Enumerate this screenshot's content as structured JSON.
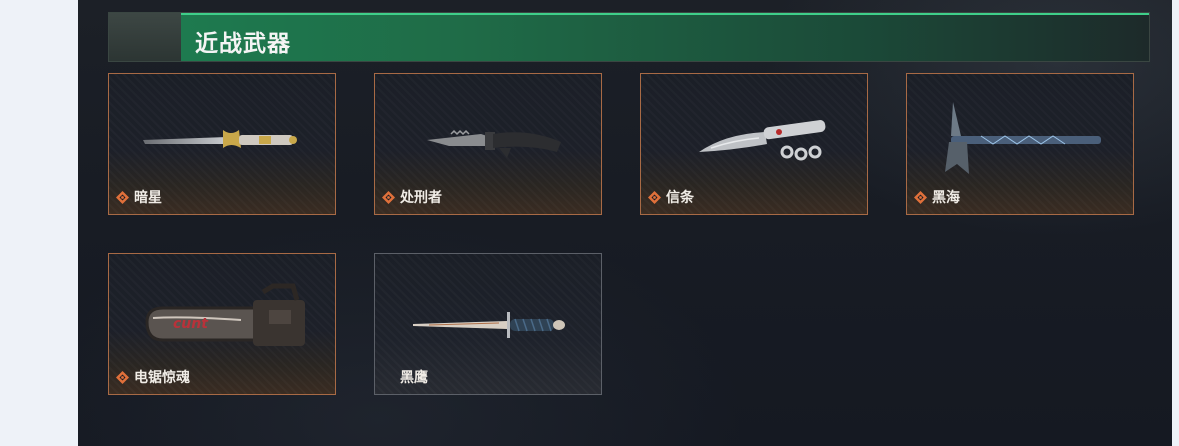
{
  "section": {
    "title": "近战武器"
  },
  "weapons": [
    {
      "name": "暗星",
      "rarity_icon": "orange-diamond-icon"
    },
    {
      "name": "处刑者",
      "rarity_icon": "orange-diamond-icon"
    },
    {
      "name": "信条",
      "rarity_icon": "orange-diamond-icon"
    },
    {
      "name": "黑海",
      "rarity_icon": "orange-diamond-icon"
    },
    {
      "name": "电锯惊魂",
      "rarity_icon": "orange-diamond-icon"
    },
    {
      "name": "黑鹰",
      "rarity_icon": ""
    }
  ],
  "colors": {
    "header_accent": "#1e7a4f",
    "card_border_orange": "#a86a45",
    "card_border_grey": "#5c6068",
    "rarity_orange": "#e0703a"
  }
}
